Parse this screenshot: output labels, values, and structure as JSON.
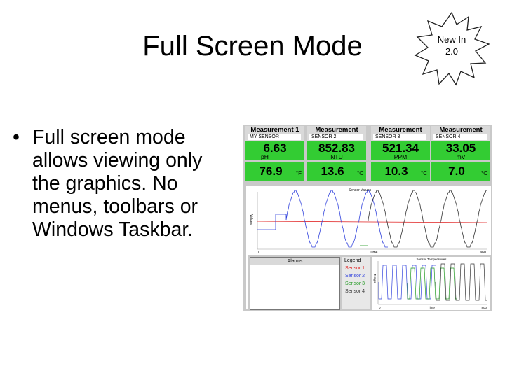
{
  "slide": {
    "title": "Full Screen Mode",
    "badge": {
      "line1": "New In",
      "line2": "2.0"
    },
    "bullet": "Full screen mode allows viewing only the graphics.  No menus, toolbars or Windows Taskbar."
  },
  "app": {
    "tiles": [
      {
        "title": "Measurement 1",
        "sensor": "MY SENSOR",
        "value": "6.63",
        "unit": "pH",
        "value2": "76.9",
        "unit2": "°F"
      },
      {
        "title": "Measurement",
        "sensor": "SENSOR 2",
        "value": "852.83",
        "unit": "NTU",
        "value2": "13.6",
        "unit2": "°C"
      },
      {
        "title": "Measurement",
        "sensor": "SENSOR 3",
        "value": "521.34",
        "unit": "PPM",
        "value2": "10.3",
        "unit2": "°C"
      },
      {
        "title": "Measurement",
        "sensor": "SENSOR 4",
        "value": "33.05",
        "unit": "mV",
        "value2": "7.0",
        "unit2": "°C"
      }
    ],
    "main_chart": {
      "title": "Sensor Values",
      "ylabel": "Values",
      "xlabel": "Time",
      "x_start": "0",
      "x_end": "960"
    },
    "alarms": {
      "title": "Alarms"
    },
    "legend": {
      "title": "Legend",
      "items": [
        {
          "label": "Sensor 1",
          "color": "#e02020"
        },
        {
          "label": "Sensor 2",
          "color": "#3344dd"
        },
        {
          "label": "Sensor 3",
          "color": "#229922"
        },
        {
          "label": "Sensor 4",
          "color": "#333333"
        }
      ]
    },
    "temp_chart": {
      "title": "Sensor Temperatures",
      "ylabel": "Temps",
      "xlabel": "Time",
      "x_start": "0",
      "x_end": "800"
    },
    "colors": {
      "tile_green": "#33cc33",
      "panel_gray": "#c9c9c9"
    }
  }
}
